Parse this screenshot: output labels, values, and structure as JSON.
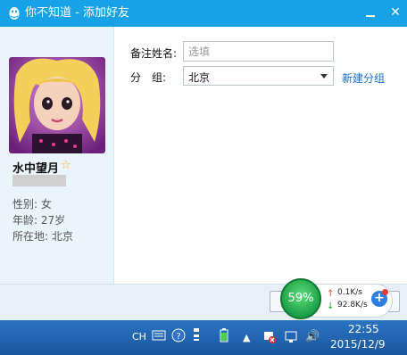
{
  "window": {
    "title": "你不知道 - 添加好友",
    "minimize_icon": "minimize-icon",
    "close_icon": "close-icon",
    "close_glyph": "✕"
  },
  "profile": {
    "nickname": "水中望月",
    "vip_icon": "star-icon",
    "gender_label": "性别:",
    "gender": "女",
    "age_label": "年龄:",
    "age": "27岁",
    "location_label": "所在地:",
    "location": "北京"
  },
  "form": {
    "remark_label": "备注姓名:",
    "remark_placeholder": "选填",
    "group_label": "分　组:",
    "group_value": "北京",
    "new_group_link": "新建分组"
  },
  "net_monitor": {
    "cpu_percent": "59%",
    "upload": "0.1K/s",
    "download": "92.8K/s"
  },
  "taskbar": {
    "ime": "CH",
    "time": "22:55",
    "date": "2015/12/9"
  },
  "colors": {
    "titlebar": "#17a2e8",
    "panel": "#eaf4fb",
    "link": "#1a6cc4",
    "taskbar": "#1f5fa8"
  }
}
